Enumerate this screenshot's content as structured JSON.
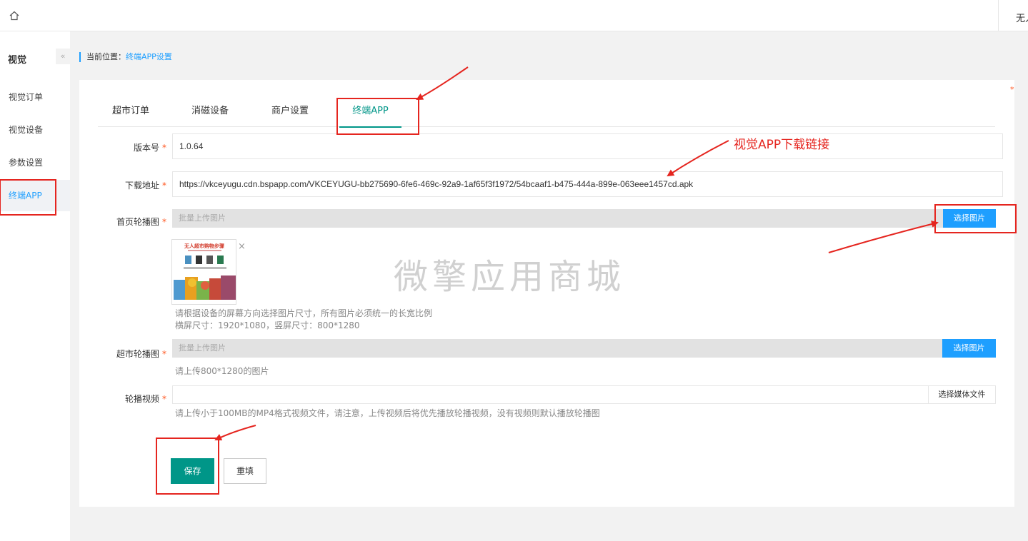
{
  "topbar": {
    "user_text": "无人"
  },
  "sidebar": {
    "title": "视觉",
    "collapse_glyph": "«",
    "items": [
      {
        "label": "视觉订单"
      },
      {
        "label": "视觉设备"
      },
      {
        "label": "参数设置"
      },
      {
        "label": "终端APP"
      }
    ]
  },
  "breadcrumb": {
    "prefix": "当前位置：",
    "current": "终端APP设置"
  },
  "tabs": [
    {
      "label": "超市订单"
    },
    {
      "label": "消磁设备"
    },
    {
      "label": "商户设置"
    },
    {
      "label": "终端APP"
    }
  ],
  "form": {
    "version": {
      "label": "版本号",
      "value": "1.0.64"
    },
    "download": {
      "label": "下载地址",
      "value": "https://vkceyugu.cdn.bspapp.com/VKCEYUGU-bb275690-6fe6-469c-92a9-1af65f3f1972/54bcaaf1-b475-444a-899e-063eee1457cd.apk"
    },
    "home_carousel": {
      "label": "首页轮播图",
      "placeholder": "批量上传图片",
      "button": "选择图片",
      "hint1": "请根据设备的屏幕方向选择图片尺寸，所有图片必须统一的长宽比例",
      "hint2": "横屏尺寸：1920*1080，竖屏尺寸：800*1280"
    },
    "market_carousel": {
      "label": "超市轮播图",
      "placeholder": "批量上传图片",
      "button": "选择图片",
      "hint": "请上传800*1280的图片"
    },
    "video": {
      "label": "轮播视频",
      "button": "选择媒体文件",
      "hint": "请上传小于100MB的MP4格式视频文件，请注意，上传视频后将优先播放轮播视频，没有视频则默认播放轮播图"
    },
    "required_mark": "*",
    "thumb_close": "×",
    "thumb_title": "无人超市购物步骤"
  },
  "buttons": {
    "save": "保存",
    "reset": "重填"
  },
  "watermark": "微擎应用商城",
  "annotation": {
    "text": "视觉APP下载链接"
  },
  "colors": {
    "primary": "#009688",
    "blue": "#1e9fff",
    "annotation_red": "#e5251f"
  }
}
